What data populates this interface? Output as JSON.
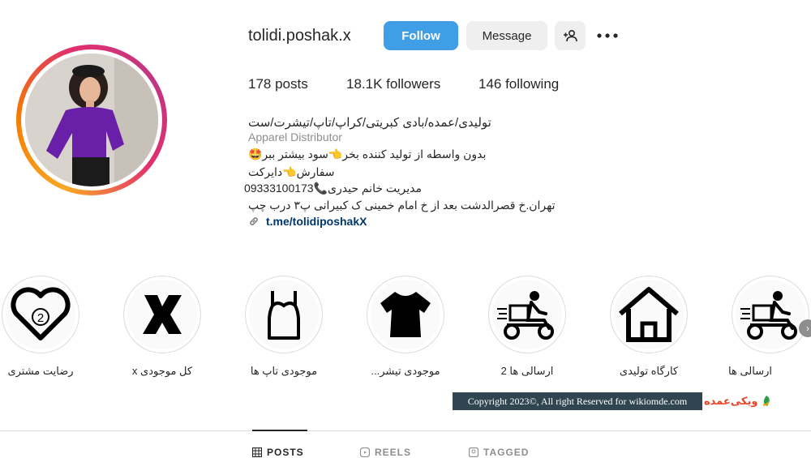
{
  "profile": {
    "username": "tolidi.poshak.x",
    "follow_label": "Follow",
    "message_label": "Message",
    "suggest_icon": "person-add-icon",
    "more_icon": "more-horizontal-icon",
    "stats": {
      "posts": "178 posts",
      "followers": "18.1K followers",
      "following": "146 following"
    },
    "bio": {
      "title": "تولیدی/عمده/بادی کبریتی/کراپ/تاپ/تیشرت/ست",
      "category": "Apparel Distributor",
      "line1": "بدون واسطه از تولید کننده بخر👈سود بیشتر ببر🤩",
      "line2": "سفارش👈دایرکت",
      "line3": "مدیریت خانم حیدری📞09333100173",
      "line4": "تهران.خ قصرالدشت بعد از خ امام خمینی ک کبیرانی پ۳ درب چپ",
      "link": "t.me/tolidiposhakX"
    }
  },
  "highlights": [
    {
      "label": "رضایت مشتری",
      "icon": "heart-2-icon"
    },
    {
      "label": "کل موجودی x",
      "icon": "letter-x-icon"
    },
    {
      "label": "موجودی تاپ ها",
      "icon": "tank-top-icon"
    },
    {
      "label": "موجودی تیشر...",
      "icon": "tshirt-icon"
    },
    {
      "label": "ارسالی ها 2",
      "icon": "delivery-scooter-icon"
    },
    {
      "label": "کارگاه تولیدی",
      "icon": "house-icon"
    },
    {
      "label": "ارسالی ها",
      "icon": "delivery-scooter-icon"
    }
  ],
  "watermark": {
    "copyright": "Copyright 2023©, All right Reserved for wikiomde.com",
    "logo_text": "ویکی‌عمده"
  },
  "tabs": [
    {
      "label": "POSTS",
      "icon": "grid-icon"
    },
    {
      "label": "REELS",
      "icon": "reels-icon"
    },
    {
      "label": "TAGGED",
      "icon": "tagged-icon"
    }
  ],
  "colors": {
    "follow_button": "#3f9ee6",
    "link": "#00376b",
    "watermark_bg": "#2f4550"
  }
}
